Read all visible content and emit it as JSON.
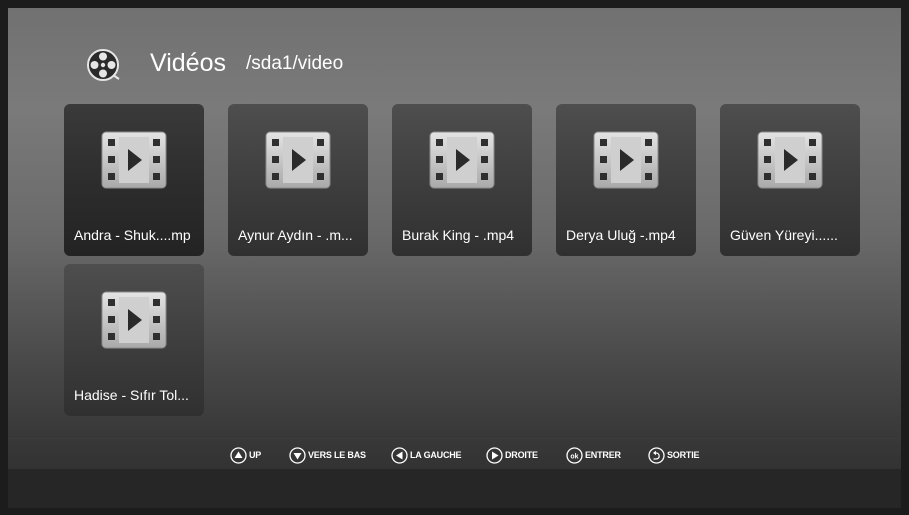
{
  "header": {
    "title": "Vidéos",
    "path": "/sda1/video",
    "icon": "film-reel-icon"
  },
  "videos": [
    {
      "label": "Andra - Shuk....mp",
      "icon": "video-file-icon",
      "selected": true
    },
    {
      "label": "Aynur Aydın - .m...",
      "icon": "video-file-icon"
    },
    {
      "label": "Burak King - .mp4",
      "icon": "video-file-icon"
    },
    {
      "label": "Derya Uluğ -.mp4",
      "icon": "video-file-icon"
    },
    {
      "label": "Güven Yüreyi......",
      "icon": "video-file-icon"
    },
    {
      "label": "Hadise - Sıfır Tol...",
      "icon": "video-file-icon"
    }
  ],
  "hints": [
    {
      "label": "UP",
      "icon": "arrow-up-circle-icon"
    },
    {
      "label": "VERS LE BAS",
      "icon": "arrow-down-circle-icon"
    },
    {
      "label": "LA GAUCHE",
      "icon": "arrow-left-circle-icon"
    },
    {
      "label": "DROITE",
      "icon": "arrow-right-circle-icon"
    },
    {
      "label": "ENTRER",
      "icon": "ok-circle-icon",
      "glyph": "ok"
    },
    {
      "label": "SORTIE",
      "icon": "return-circle-icon"
    }
  ],
  "colors": {
    "text": "#ffffff",
    "tile": "#3d3d3d",
    "tile_selected": "#2c2c2c",
    "icon_frame": "#c9c9c9"
  }
}
